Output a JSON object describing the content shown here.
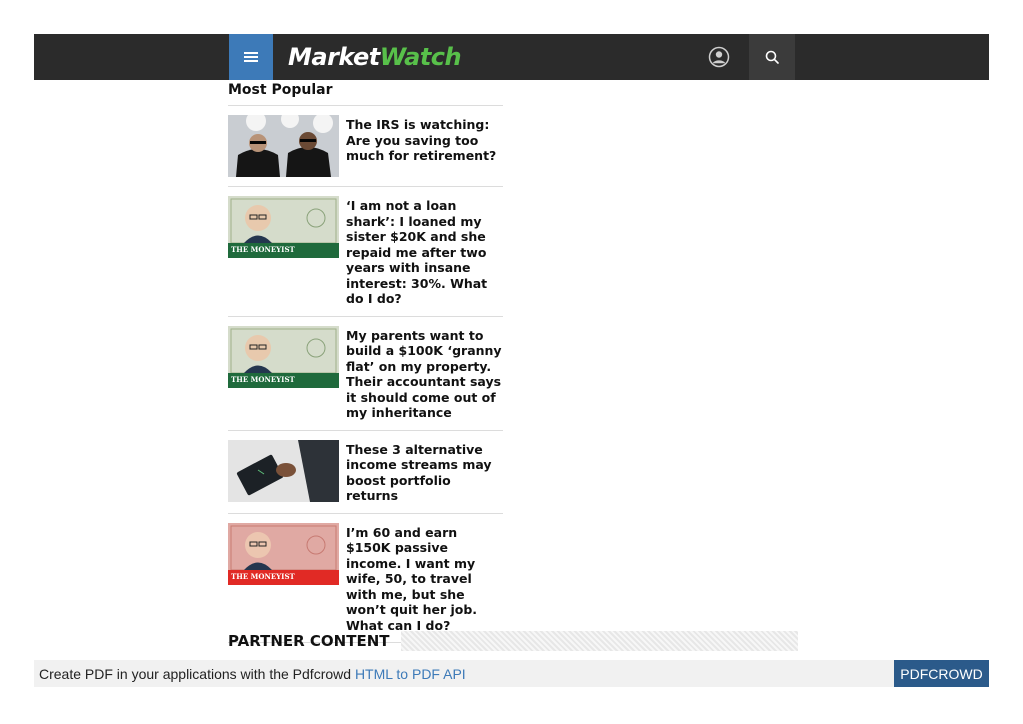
{
  "header": {
    "logo_part1": "Market",
    "logo_part2": "Watch",
    "accent_color": "#3d7ab8",
    "bg_color": "#2b2b2b",
    "icons": [
      "menu-icon",
      "user-icon",
      "search-icon"
    ]
  },
  "most_popular": {
    "title": "Most Popular",
    "items": [
      {
        "title": "The IRS is watching: Are you saving too much for retirement?",
        "thumb": "agents-photo"
      },
      {
        "title": "‘I am not a loan shark’: I loaned my sister $20K and she repaid me after two years with insane interest: 30%. What do I do?",
        "thumb": "moneyist-green",
        "caption": "THE MONEYIST"
      },
      {
        "title": "My parents want to build a $100K ‘granny flat’ on my property. Their accountant says it should come out of my inheritance",
        "thumb": "moneyist-green",
        "caption": "THE MONEYIST"
      },
      {
        "title": "These 3 alternative income streams may boost portfolio returns",
        "thumb": "tablet-photo"
      },
      {
        "title": "I’m 60 and earn $150K passive income. I want my wife, 50, to travel with me, but she won’t quit her job. What can I do?",
        "thumb": "moneyist-red",
        "caption": "THE MONEYIST"
      }
    ]
  },
  "partner": {
    "label": "PARTNER CONTENT"
  },
  "pdf_banner": {
    "text_before": "Create PDF in your applications with the Pdfcrowd ",
    "link": "HTML to PDF API",
    "brand": "PDFCROWD"
  }
}
